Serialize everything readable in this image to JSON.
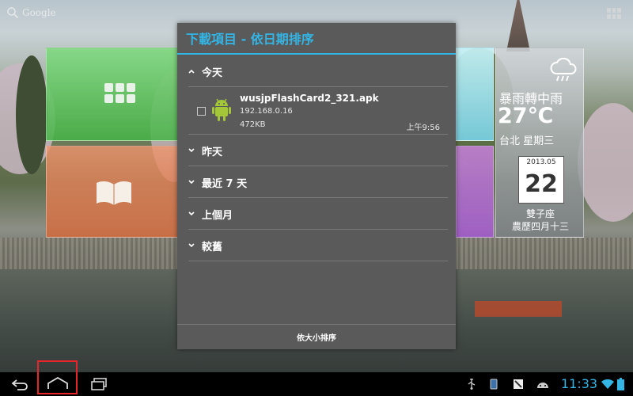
{
  "home": {
    "search_label": "Google"
  },
  "weather": {
    "condition": "暴雨轉中雨",
    "temperature": "27℃",
    "location_day": "台北 星期三",
    "calendar_month": "2013.05",
    "calendar_day": "22",
    "zodiac": "雙子座",
    "lunar_date": "農歷四月十三"
  },
  "dialog": {
    "title": "下載項目 - 依日期排序",
    "groups": [
      {
        "label": "今天",
        "expanded": true
      },
      {
        "label": "昨天",
        "expanded": false
      },
      {
        "label": "最近 7 天",
        "expanded": false
      },
      {
        "label": "上個月",
        "expanded": false
      },
      {
        "label": "較舊",
        "expanded": false
      }
    ],
    "item": {
      "filename": "wusjpFlashCard2_321.apk",
      "host": "192.168.0.16",
      "size": "472KB",
      "time": "上午9:56",
      "checked": false
    },
    "footer_button": "依大小排序"
  },
  "statusbar": {
    "time": "11:33"
  },
  "colors": {
    "accent": "#33b5e5",
    "highlight": "#e8252a",
    "android": "#a4c639"
  },
  "icons": {
    "back": "back-icon",
    "home": "home-icon",
    "recent": "recent-apps-icon",
    "usb": "usb-icon",
    "wifi": "wifi-icon",
    "battery": "battery-icon"
  }
}
